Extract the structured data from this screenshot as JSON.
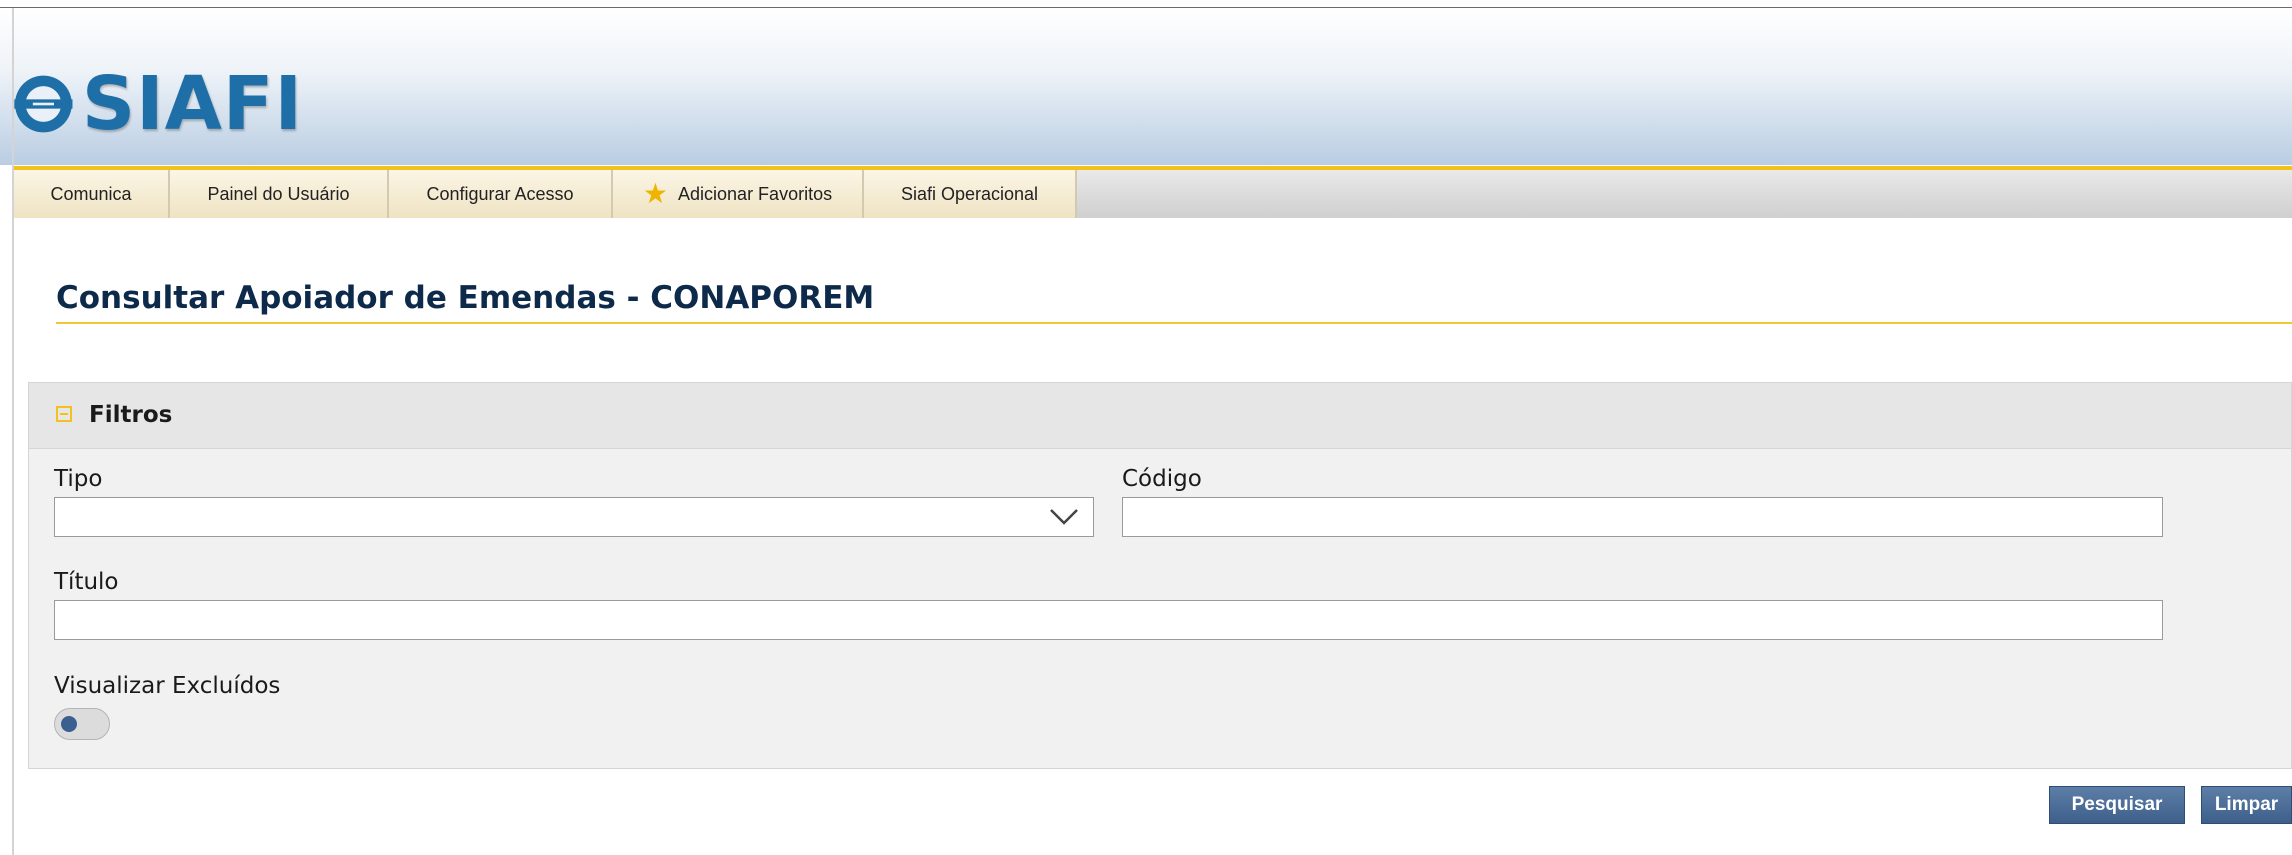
{
  "app": {
    "logo_text": "SIAFI"
  },
  "menu": {
    "items": [
      {
        "label": "Comunica"
      },
      {
        "label": "Painel do Usuário"
      },
      {
        "label": "Configurar Acesso"
      },
      {
        "label": "Adicionar Favoritos",
        "icon": "star-icon"
      },
      {
        "label": "Siafi Operacional"
      }
    ]
  },
  "page": {
    "title": "Consultar Apoiador de Emendas - CONAPOREM"
  },
  "filters": {
    "title": "Filtros",
    "tipo_label": "Tipo",
    "tipo_value": "",
    "codigo_label": "Código",
    "codigo_value": "",
    "titulo_label": "Título",
    "titulo_value": "",
    "excluidos_label": "Visualizar Excluídos",
    "excluidos_on": false
  },
  "actions": {
    "search_label": "Pesquisar",
    "clear_label": "Limpar"
  },
  "colors": {
    "accent": "#f2c11b",
    "button": "#4a6d98",
    "title": "#0e2a4a",
    "logo": "#1e6fa7"
  }
}
